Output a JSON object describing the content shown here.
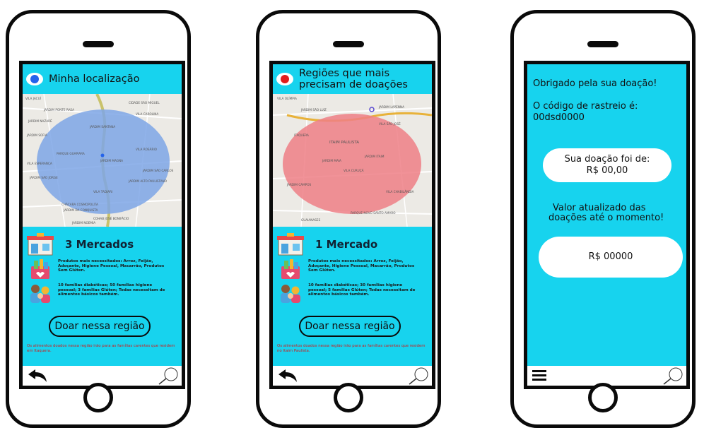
{
  "phone1": {
    "header_title": "Minha localização",
    "pin_color": "#2563eb",
    "map_labels": [
      "VILA JACUÍ",
      "CIDADE SÃO MIGUEL",
      "JARDIM PONTE RASA",
      "VILA CAROLINA",
      "JARDIM SANTANA",
      "PARQUE GUAPIARA",
      "JARDIM MAGNA",
      "VILA TADIARI",
      "JARDIM SOFIA",
      "VILA ROSÁRIO",
      "JARDIM NAZARÉ",
      "JARDIM SÃO CARLOS",
      "CHÁCARA COSMOPOLITA",
      "JARDIM DA CONQUISTA",
      "JARDIM ALTO PAULISTANO",
      "JARDIM SÃO JORGE",
      "VILA ESPERANÇA",
      "COHAB JOSÉ BONIFÁCIO",
      "JARDIM NOEMIA"
    ],
    "markets_count": "3 Mercados",
    "products_text": "Produtos mais necessitados: Arroz, Feijão, Adoçante, Higiene Pessoal, Macarrão, Produtos Sem Glúten.",
    "families_text": "10 famílias diabéticas; 50 famílias higiene pessoal; 3 famílias Glúten; Todas necessitam de alimentos básicos também.",
    "donate_button": "Doar nessa região",
    "note": "Os alimentos doados nessa região irão para as famílias carentes que residem em Itaquera."
  },
  "phone2": {
    "header_title_line1": "Regiões que mais",
    "header_title_line2": "precisam de doações",
    "pin_color": "#e11d1d",
    "map_labels": [
      "VILA OLÍMPIA",
      "ITAIM PAULISTA",
      "JARDIM SÃO LUIZ",
      "VILA SÃO JOSÉ",
      "JARDIM ITAIM",
      "VILA CURUÇÁ",
      "JARDIM MAIA",
      "JARDIM CAMPOS",
      "PARQUE NOVO SANTO AMARO",
      "ITAQUERA",
      "VILA CHABILÂNDIA",
      "GUAIANASES",
      "JARDIM LAPENNA"
    ],
    "markets_count": "1 Mercado",
    "products_text": "Produtos mais necessitados: Arroz, Feijão, Adoçante, Higiene Pessoal, Macarrão, Produtos Sem Glúten.",
    "families_text": "10 famílias diabéticas; 30 famílias higiene pessoal; 5 famílias Glúten; Todas necessitam de alimentos básicos também.",
    "donate_button": "Doar nessa região",
    "note": "Os alimentos doados nessa região irão para as famílias carentes que residem no Itaim Paulista."
  },
  "phone3": {
    "thanks": "Obrigado pela sua doação!",
    "code_label": "O código de rastreio é:",
    "code_value": "00dsd0000",
    "donation_line1": "Sua doação foi de:",
    "donation_line2": "R$ 00,00",
    "total_line1": "Valor atualizado das",
    "total_line2": "doações até o momento!",
    "total_value": "R$ 00000"
  },
  "colors": {
    "screen_bg": "#17d3ee",
    "circle_blue": "#7ea6e6",
    "circle_red": "#ee7f86",
    "note_red": "#d11a1a"
  }
}
